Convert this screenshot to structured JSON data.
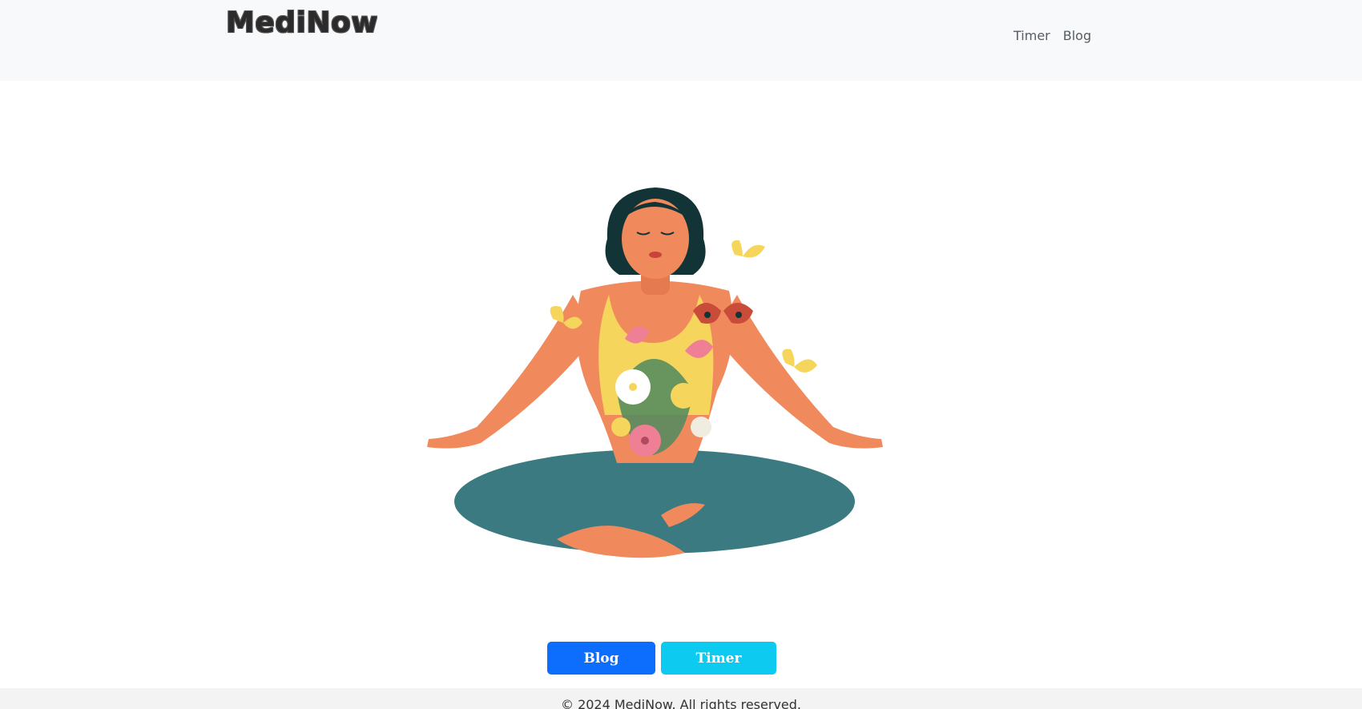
{
  "navbar": {
    "brand": "MediNow",
    "links": [
      {
        "label": "Timer"
      },
      {
        "label": "Blog"
      }
    ]
  },
  "hero": {
    "colors": {
      "skin": "#f08a5d",
      "hair": "#123437",
      "top": "#f6d55c",
      "pants": "#3a7a80",
      "pink": "#ef7f95",
      "leaf": "#4f8a5e"
    }
  },
  "actions": {
    "blog_label": "Blog",
    "timer_label": "Timer",
    "blog_color": "#0d6efd",
    "timer_color": "#0dcaf0"
  },
  "footer": {
    "text": "© 2024 MediNow. All rights reserved."
  }
}
